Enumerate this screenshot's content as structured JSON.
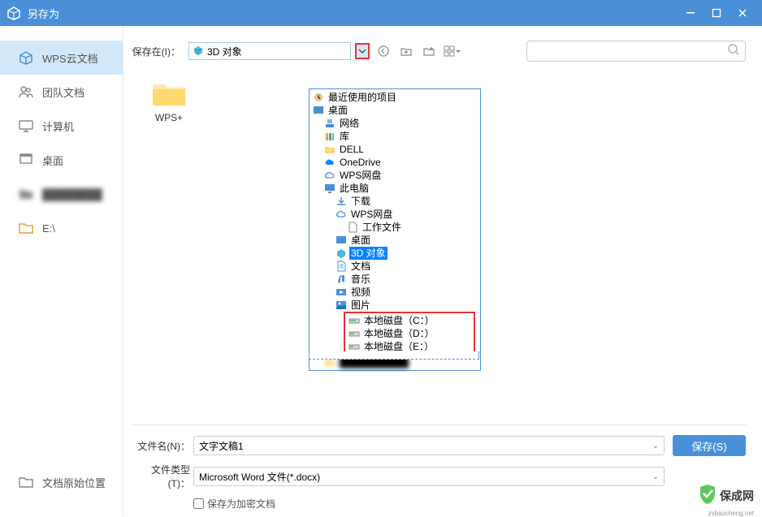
{
  "window": {
    "title": "另存为"
  },
  "sidebar": {
    "items": [
      {
        "label": "WPS云文档",
        "icon": "cube"
      },
      {
        "label": "团队文档",
        "icon": "team"
      },
      {
        "label": "计算机",
        "icon": "computer"
      },
      {
        "label": "桌面",
        "icon": "desktop"
      },
      {
        "label": "",
        "icon": "folder",
        "blurred": true
      },
      {
        "label": "E:\\",
        "icon": "folder"
      }
    ],
    "bottom": {
      "label": "文档原始位置",
      "icon": "folder"
    }
  },
  "toolbar": {
    "save_in_label": "保存在(I)：",
    "save_in_value": "3D 对象"
  },
  "grid": {
    "items": [
      {
        "name": "WPS+"
      }
    ]
  },
  "tree": [
    {
      "level": 0,
      "icon": "recent",
      "label": "最近使用的项目"
    },
    {
      "level": 0,
      "icon": "desktop",
      "label": "桌面"
    },
    {
      "level": 1,
      "icon": "network",
      "label": "网络"
    },
    {
      "level": 1,
      "icon": "library",
      "label": "库"
    },
    {
      "level": 1,
      "icon": "folder",
      "label": "DELL"
    },
    {
      "level": 1,
      "icon": "onedrive",
      "label": "OneDrive"
    },
    {
      "level": 1,
      "icon": "cloud",
      "label": "WPS网盘"
    },
    {
      "level": 1,
      "icon": "pc",
      "label": "此电脑"
    },
    {
      "level": 2,
      "icon": "download",
      "label": "下载"
    },
    {
      "level": 2,
      "icon": "cloud",
      "label": "WPS网盘"
    },
    {
      "level": 3,
      "icon": "doc",
      "label": "工作文件"
    },
    {
      "level": 2,
      "icon": "desktop",
      "label": "桌面"
    },
    {
      "level": 2,
      "icon": "3d",
      "label": "3D 对象",
      "selected": true
    },
    {
      "level": 2,
      "icon": "doc",
      "label": "文档"
    },
    {
      "level": 2,
      "icon": "music",
      "label": "音乐"
    },
    {
      "level": 2,
      "icon": "video",
      "label": "视频"
    },
    {
      "level": 2,
      "icon": "picture",
      "label": "图片"
    }
  ],
  "tree_drives": [
    {
      "label": "本地磁盘（C：）"
    },
    {
      "label": "本地磁盘（D：）"
    },
    {
      "label": "本地磁盘（E：）"
    }
  ],
  "form": {
    "filename_label": "文件名(N)：",
    "filename_value": "文字文稿1",
    "filetype_label": "文件类型(T)：",
    "filetype_value": "Microsoft Word 文件(*.docx)",
    "encrypt_label": "保存为加密文档",
    "save_btn": "保存(S)"
  },
  "watermark": {
    "text": "保成网",
    "sub": "zsbaocheng.net"
  }
}
